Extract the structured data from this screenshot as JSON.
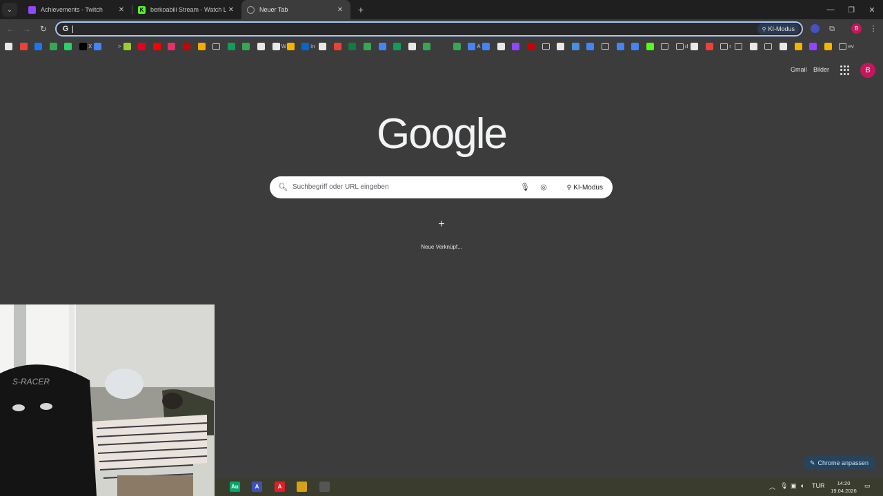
{
  "tabs": [
    {
      "title": "Achievements - Twitch",
      "favicon_color": "#9146ff",
      "active": false
    },
    {
      "title": "berkoabiii Stream - Watch Live",
      "favicon_color": "#53fc18",
      "active": false
    },
    {
      "title": "Neuer Tab",
      "favicon_color": "#9aa0a6",
      "active": true
    }
  ],
  "toolbar": {
    "omnibox_value": "",
    "omnibox_badge": "G",
    "ki_mode_label": "KI-Modus",
    "profile_initial": "B"
  },
  "bookmarks": [
    {
      "label": "",
      "color": "#e8e8e8"
    },
    {
      "label": "",
      "color": "#ea4335"
    },
    {
      "label": "",
      "color": "#1877f2"
    },
    {
      "label": "",
      "color": "#34a853"
    },
    {
      "label": "",
      "color": "#25d366"
    },
    {
      "label": "X",
      "color": "#000"
    },
    {
      "label": "",
      "color": "#4285f4"
    },
    {
      "label": ">",
      "color": "#3c3c3c"
    },
    {
      "label": "",
      "color": "#9acd32"
    },
    {
      "label": "",
      "color": "#e60023"
    },
    {
      "label": "",
      "color": "#ff0000"
    },
    {
      "label": "",
      "color": "#e1306c"
    },
    {
      "label": "",
      "color": "#cc0000"
    },
    {
      "label": "",
      "color": "#f9ab00"
    },
    {
      "label": "",
      "folder": true
    },
    {
      "label": "",
      "color": "#0f9d58"
    },
    {
      "label": "",
      "color": "#34a853"
    },
    {
      "label": "",
      "color": "#e8e8e8"
    },
    {
      "label": "W",
      "color": "#e8e8e8"
    },
    {
      "label": "",
      "color": "#f4b400"
    },
    {
      "label": "in",
      "color": "#0a66c2"
    },
    {
      "label": "",
      "color": "#e8e8e8"
    },
    {
      "label": "",
      "color": "#ea4335"
    },
    {
      "label": "",
      "color": "#107c41"
    },
    {
      "label": "",
      "color": "#34a853"
    },
    {
      "label": "",
      "color": "#4285f4"
    },
    {
      "label": "",
      "color": "#0f9d58"
    },
    {
      "label": "",
      "color": "#e8e8e8"
    },
    {
      "label": "",
      "color": "#34a853"
    },
    {
      "label": "",
      "color": "#3c3c3c"
    },
    {
      "label": "",
      "color": "#34a853"
    },
    {
      "label": "A",
      "color": "#4285f4"
    },
    {
      "label": "",
      "color": "#4285f4"
    },
    {
      "label": "",
      "color": "#e8e8e8"
    },
    {
      "label": "",
      "color": "#9146ff"
    },
    {
      "label": "",
      "color": "#cc0000"
    },
    {
      "label": "",
      "folder": true
    },
    {
      "label": "",
      "color": "#e8e8e8"
    },
    {
      "label": "",
      "color": "#4a90e2"
    },
    {
      "label": "",
      "color": "#4285f4"
    },
    {
      "label": "",
      "folder": true
    },
    {
      "label": "",
      "color": "#4285f4"
    },
    {
      "label": "",
      "color": "#4285f4"
    },
    {
      "label": "",
      "color": "#53fc18"
    },
    {
      "label": "",
      "folder": true
    },
    {
      "label": "d",
      "folder": true
    },
    {
      "label": "",
      "color": "#e8e8e8"
    },
    {
      "label": "",
      "color": "#ea4335"
    },
    {
      "label": "r",
      "folder": true
    },
    {
      "label": "",
      "folder": true
    },
    {
      "label": "",
      "color": "#e8e8e8"
    },
    {
      "label": "",
      "folder": true
    },
    {
      "label": "",
      "color": "#e8e8e8"
    },
    {
      "label": "",
      "color": "#f4b400"
    },
    {
      "label": "",
      "color": "#9146ff"
    },
    {
      "label": "",
      "color": "#f4b400"
    },
    {
      "label": "ev",
      "folder": true
    }
  ],
  "ntp": {
    "gmail_label": "Gmail",
    "images_label": "Bilder",
    "avatar_initial": "B",
    "logo_text": "Google",
    "search_placeholder": "Suchbegriff oder URL eingeben",
    "search_ki_label": "KI-Modus",
    "shortcut_add_label": "Neue Verknüpf...",
    "customize_label": "Chrome anpassen"
  },
  "taskbar": {
    "apps": [
      {
        "name": "audition",
        "label": "Au",
        "color": "#00a86b"
      },
      {
        "name": "affinity",
        "label": "A",
        "color": "#3f51b5"
      },
      {
        "name": "acrobat",
        "label": "A",
        "color": "#e01e2a"
      },
      {
        "name": "app-yellow",
        "label": "",
        "color": "#d6a017"
      },
      {
        "name": "obs",
        "label": "",
        "color": "#555"
      }
    ],
    "language": "TUR",
    "time": "14:20",
    "date": "19.04.2026"
  },
  "webcam": {
    "chair_text": "S-RACER"
  }
}
